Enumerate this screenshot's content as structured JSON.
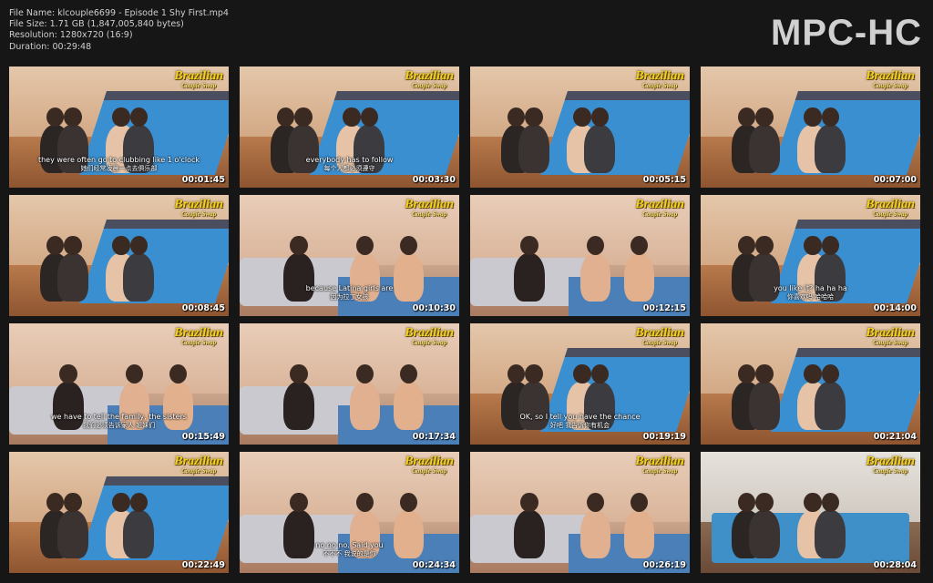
{
  "file_info": {
    "name": "File Name: klcouple6699 - Episode 1 Shy First.mp4",
    "size": "File Size: 1.71 GB (1,847,005,840 bytes)",
    "resolution": "Resolution: 1280x720 (16:9)",
    "duration": "Duration: 00:29:48"
  },
  "brand": "MPC-HC",
  "logo": {
    "line1": "Brazilian",
    "line2": "Couple Swap"
  },
  "thumbnails": [
    {
      "time": "00:01:45",
      "scene": "bed",
      "logo": true,
      "sub_en": "they were often go to clubbing like 1 o'clock",
      "sub_zh": "她们经常凌晨一点去俱乐部"
    },
    {
      "time": "00:03:30",
      "scene": "bed",
      "logo": true,
      "sub_en": "everybody has to follow",
      "sub_zh": "每个人都必须遵守"
    },
    {
      "time": "00:05:15",
      "scene": "bed",
      "logo": true,
      "sub_en": "",
      "sub_zh": ""
    },
    {
      "time": "00:07:00",
      "scene": "bed",
      "logo": true,
      "sub_en": "",
      "sub_zh": ""
    },
    {
      "time": "00:08:45",
      "scene": "bed",
      "logo": true,
      "sub_en": "",
      "sub_zh": ""
    },
    {
      "time": "00:10:30",
      "scene": "sofa",
      "logo": true,
      "sub_en": "because Latina girls are",
      "sub_zh": "因为拉丁女孩"
    },
    {
      "time": "00:12:15",
      "scene": "sofa",
      "logo": true,
      "sub_en": "",
      "sub_zh": ""
    },
    {
      "time": "00:14:00",
      "scene": "bed",
      "logo": true,
      "sub_en": "you like it? ha ha ha",
      "sub_zh": "你喜欢吗 哈哈哈"
    },
    {
      "time": "00:15:49",
      "scene": "sofa",
      "logo": true,
      "sub_en": "we have to tell the family, the sisters",
      "sub_zh": "我们必须告诉家人 姐妹们"
    },
    {
      "time": "00:17:34",
      "scene": "sofa",
      "logo": true,
      "sub_en": "",
      "sub_zh": ""
    },
    {
      "time": "00:19:19",
      "scene": "bed",
      "logo": true,
      "sub_en": "OK, so I tell you have the chance",
      "sub_zh": "好吧 我告诉你有机会"
    },
    {
      "time": "00:21:04",
      "scene": "bed",
      "logo": true,
      "sub_en": "",
      "sub_zh": ""
    },
    {
      "time": "00:22:49",
      "scene": "bed",
      "logo": true,
      "sub_en": "",
      "sub_zh": ""
    },
    {
      "time": "00:24:34",
      "scene": "sofa",
      "logo": true,
      "sub_en": "no no no. Said you",
      "sub_zh": "不不不 我说的是你"
    },
    {
      "time": "00:26:19",
      "scene": "sofa",
      "logo": true,
      "sub_en": "",
      "sub_zh": ""
    },
    {
      "time": "00:28:04",
      "scene": "room",
      "logo": true,
      "sub_en": "",
      "sub_zh": ""
    }
  ]
}
